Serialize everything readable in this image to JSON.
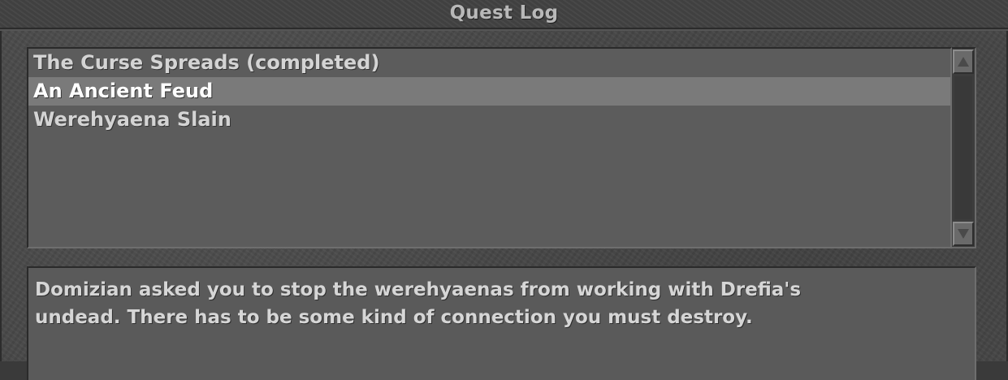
{
  "window": {
    "title": "Quest Log"
  },
  "quest_list": {
    "items": [
      {
        "label": "The Curse Spreads (completed)",
        "selected": false
      },
      {
        "label": "An Ancient Feud",
        "selected": true
      },
      {
        "label": "Werehyaena Slain",
        "selected": false
      }
    ]
  },
  "scrollbar": {
    "up_icon": "arrow-up-icon",
    "down_icon": "arrow-down-icon"
  },
  "description": {
    "text": "Domizian asked you to stop the werehyaenas from working with Drefia's\nundead. There has to be some kind of connection you must destroy."
  },
  "colors": {
    "background": "#474747",
    "list_background": "#5c5c5c",
    "selected_row": "#7a7a7a",
    "text": "#d4d4d4",
    "selected_text": "#ffffff"
  }
}
